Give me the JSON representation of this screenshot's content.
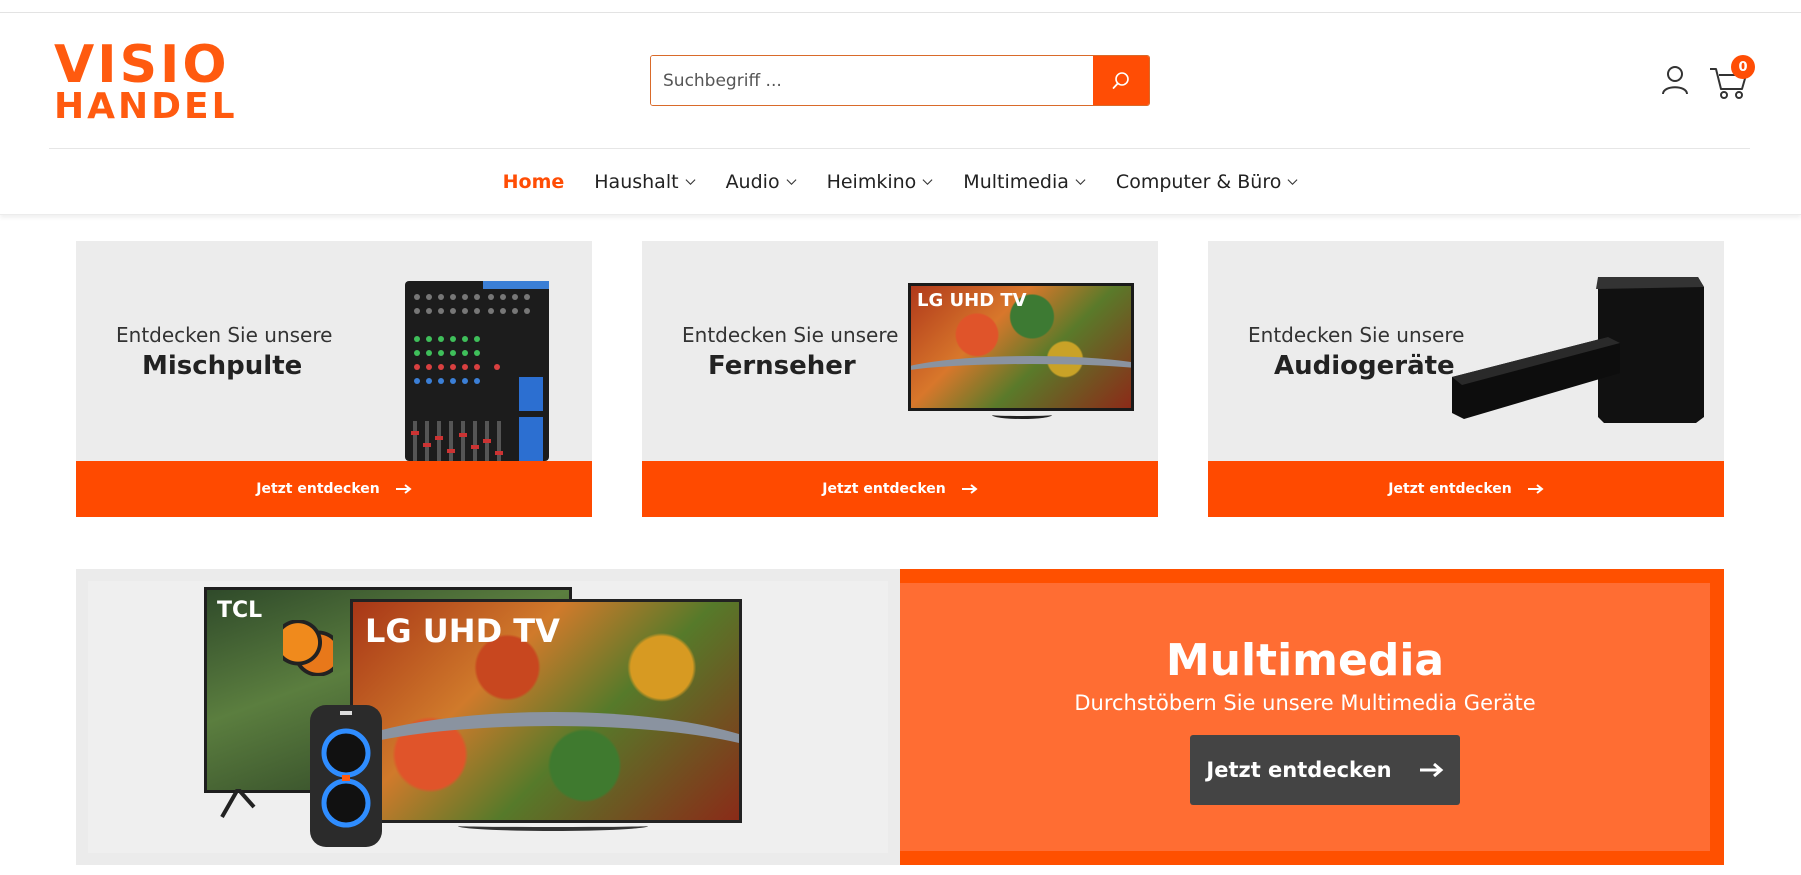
{
  "brand": {
    "line1": "VISIO",
    "line2": "HANDEL",
    "color": "#ff5a0f"
  },
  "search": {
    "placeholder": "Suchbegriff ...",
    "value": "",
    "button_icon": "search-icon"
  },
  "account": {
    "icon": "user-icon"
  },
  "cart": {
    "icon": "cart-icon",
    "count": "0"
  },
  "nav": {
    "items": [
      {
        "label": "Home",
        "active": true,
        "dropdown": false
      },
      {
        "label": "Haushalt",
        "active": false,
        "dropdown": true
      },
      {
        "label": "Audio",
        "active": false,
        "dropdown": true
      },
      {
        "label": "Heimkino",
        "active": false,
        "dropdown": true
      },
      {
        "label": "Multimedia",
        "active": false,
        "dropdown": true
      },
      {
        "label": "Computer & Büro",
        "active": false,
        "dropdown": true
      }
    ]
  },
  "tiles": [
    {
      "intro": "Entdecken Sie unsere",
      "title": "Mischpulte",
      "cta": "Jetzt entdecken",
      "image": "mixer-image"
    },
    {
      "intro": "Entdecken Sie unsere",
      "title": "Fernseher",
      "cta": "Jetzt entdecken",
      "image": "tv-image",
      "image_text": "LG UHD TV"
    },
    {
      "intro": "Entdecken Sie unsere",
      "title": "Audiogeräte",
      "cta": "Jetzt entdecken",
      "image": "soundbar-image"
    }
  ],
  "banner": {
    "title": "Multimedia",
    "subtitle": "Durchstöbern Sie unsere Multimedia Geräte",
    "cta": "Jetzt entdecken",
    "tv_small_text": "TCL",
    "tv_large_text": "LG UHD TV"
  },
  "colors": {
    "accent": "#ff4d05",
    "tile_bg": "#ececec",
    "banner_orange": "#ff6d33",
    "button_dark": "#444444"
  }
}
